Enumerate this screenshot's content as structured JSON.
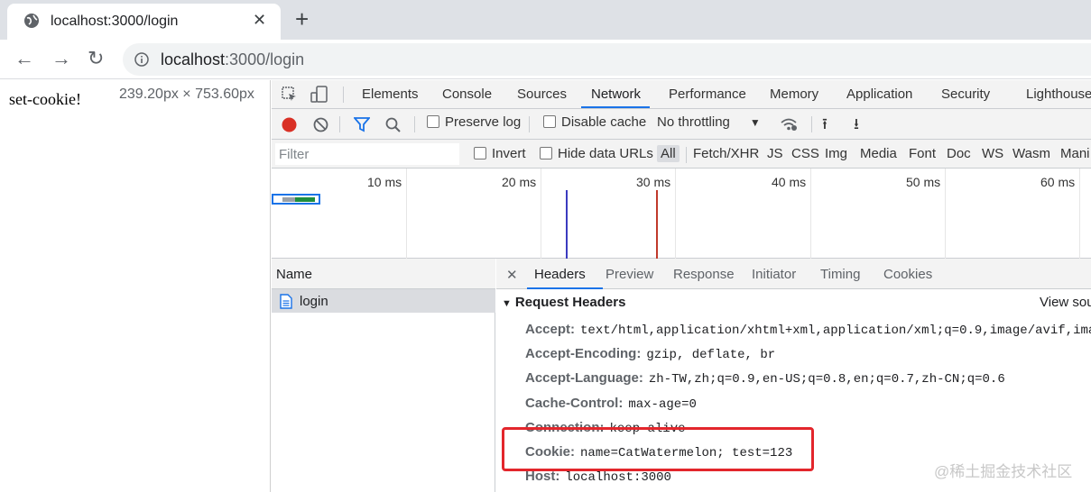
{
  "browser": {
    "tab_title": "localhost:3000/login",
    "tab_icon": "globe-icon",
    "url_host": "localhost",
    "url_path": ":3000/login"
  },
  "page": {
    "text": "set-cookie!",
    "dimensions": "239.20px × 753.60px"
  },
  "devtools": {
    "tabs": [
      "Elements",
      "Console",
      "Sources",
      "Network",
      "Performance",
      "Memory",
      "Application",
      "Security",
      "Lighthouse"
    ],
    "active_tab": "Network",
    "toolbar": {
      "preserve_log": "Preserve log",
      "disable_cache": "Disable cache",
      "throttling": "No throttling"
    },
    "filter": {
      "placeholder": "Filter",
      "invert": "Invert",
      "hide_data_urls": "Hide data URLs",
      "types": [
        "All",
        "Fetch/XHR",
        "JS",
        "CSS",
        "Img",
        "Media",
        "Font",
        "Doc",
        "WS",
        "Wasm",
        "Mani"
      ]
    },
    "timeline": {
      "ticks": [
        "10 ms",
        "20 ms",
        "30 ms",
        "40 ms",
        "50 ms",
        "60 ms"
      ],
      "dom_content_loaded_color": "#3b3bbf",
      "load_color": "#c0392b"
    },
    "requests": {
      "name_header": "Name",
      "rows": [
        "login"
      ]
    },
    "details": {
      "tabs": [
        "Headers",
        "Preview",
        "Response",
        "Initiator",
        "Timing",
        "Cookies"
      ],
      "active_tab": "Headers",
      "section_title": "Request Headers",
      "view_source": "View sou",
      "headers": [
        {
          "key": "Accept:",
          "value": "text/html,application/xhtml+xml,application/xml;q=0.9,image/avif,imag"
        },
        {
          "key": "Accept-Encoding:",
          "value": "gzip, deflate, br"
        },
        {
          "key": "Accept-Language:",
          "value": "zh-TW,zh;q=0.9,en-US;q=0.8,en;q=0.7,zh-CN;q=0.6"
        },
        {
          "key": "Cache-Control:",
          "value": "max-age=0"
        },
        {
          "key": "Connection:",
          "value": "keep-alive"
        },
        {
          "key": "Cookie:",
          "value": "name=CatWatermelon; test=123"
        },
        {
          "key": "Host:",
          "value": "localhost:3000"
        }
      ]
    }
  },
  "watermark": "@稀土掘金技术社区",
  "colors": {
    "accent": "#1a73e8",
    "highlight_box": "#e3262c",
    "record": "#d93025"
  }
}
